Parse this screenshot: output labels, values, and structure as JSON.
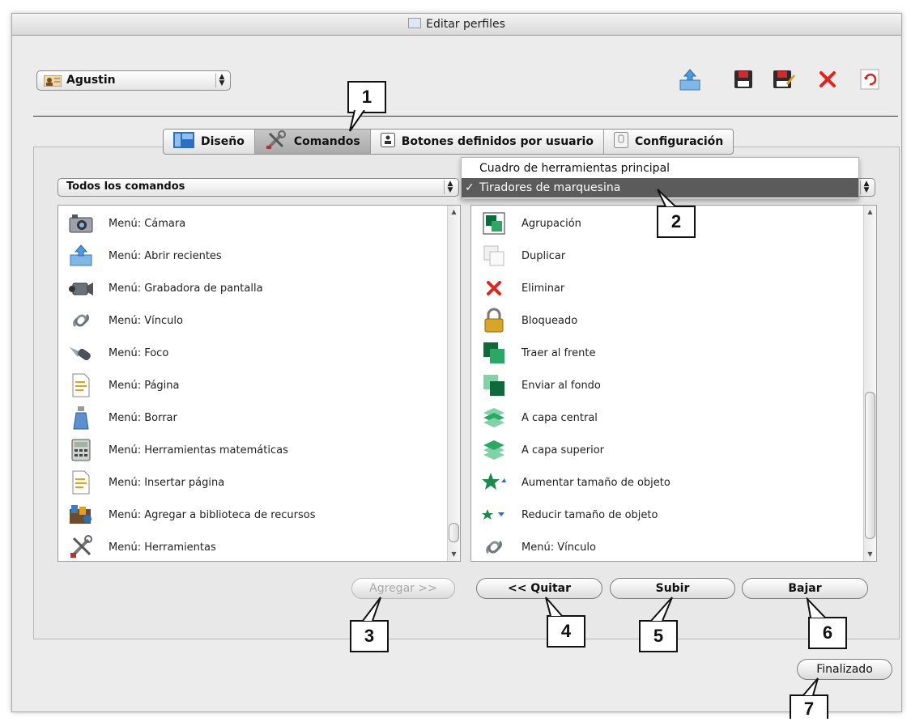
{
  "window": {
    "title": "Editar perfiles"
  },
  "profile": {
    "selected": "Agustin"
  },
  "toolbar": {
    "icons": [
      "import-icon",
      "save-icon",
      "save-as-icon",
      "delete-icon",
      "refresh-icon"
    ],
    "accent_delete": "#e4221b"
  },
  "tabs": [
    {
      "label": "Diseño",
      "icon": "layout-icon"
    },
    {
      "label": "Comandos",
      "icon": "tools-icon",
      "selected": true
    },
    {
      "label": "Botones definidos por usuario",
      "icon": "user-button-icon"
    },
    {
      "label": "Configuración",
      "icon": "settings-icon"
    }
  ],
  "left_filter": {
    "selected": "Todos los comandos"
  },
  "right_menu": {
    "items": [
      {
        "label": "Cuadro de herramientas principal",
        "checked": false
      },
      {
        "label": "Tiradores de marquesina",
        "checked": true
      }
    ],
    "check_mark": "✓"
  },
  "left_list": [
    {
      "label": "Menú: Cámara",
      "icon": "camera-icon"
    },
    {
      "label": "Menú: Abrir recientes",
      "icon": "open-recent-icon"
    },
    {
      "label": "Menú: Grabadora de pantalla",
      "icon": "video-camera-icon"
    },
    {
      "label": "Menú: Vínculo",
      "icon": "link-icon"
    },
    {
      "label": "Menú: Foco",
      "icon": "spotlight-icon"
    },
    {
      "label": "Menú: Página",
      "icon": "page-icon"
    },
    {
      "label": "Menú: Borrar",
      "icon": "clear-spray-icon"
    },
    {
      "label": "Menú: Herramientas matemáticas",
      "icon": "calculator-icon"
    },
    {
      "label": "Menú: Insertar página",
      "icon": "insert-page-icon"
    },
    {
      "label": "Menú: Agregar a biblioteca de recursos",
      "icon": "resource-library-icon"
    },
    {
      "label": "Menú: Herramientas",
      "icon": "tools-icon"
    }
  ],
  "right_list": [
    {
      "label": "Agrupación",
      "icon": "group-icon"
    },
    {
      "label": "Duplicar",
      "icon": "duplicate-icon"
    },
    {
      "label": "Eliminar",
      "icon": "delete-icon"
    },
    {
      "label": "Bloqueado",
      "icon": "lock-icon"
    },
    {
      "label": "Traer al frente",
      "icon": "bring-front-icon"
    },
    {
      "label": "Enviar al fondo",
      "icon": "send-back-icon"
    },
    {
      "label": "A capa central",
      "icon": "layer-middle-icon"
    },
    {
      "label": "A capa superior",
      "icon": "layer-top-icon"
    },
    {
      "label": "Aumentar tamaño de objeto",
      "icon": "grow-icon"
    },
    {
      "label": "Reducir tamaño de objeto",
      "icon": "shrink-icon"
    },
    {
      "label": "Menú: Vínculo",
      "icon": "link-icon"
    }
  ],
  "buttons": {
    "add": "Agregar >>",
    "remove": "<< Quitar",
    "up": "Subir",
    "down": "Bajar",
    "done": "Finalizado"
  },
  "callouts": [
    "1",
    "2",
    "3",
    "4",
    "5",
    "6",
    "7"
  ]
}
